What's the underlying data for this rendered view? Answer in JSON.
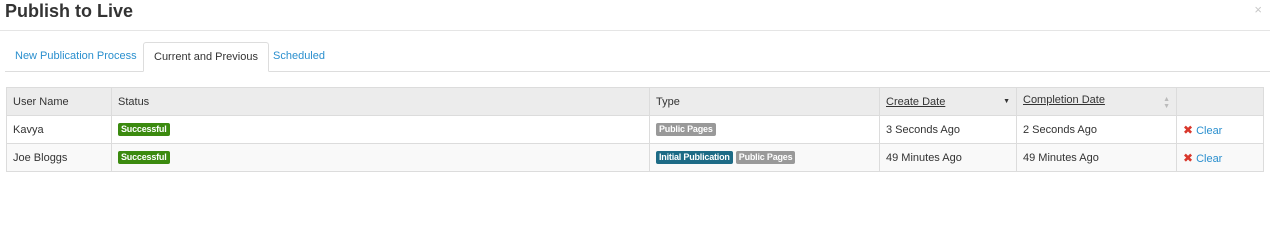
{
  "dialog": {
    "title": "Publish to Live",
    "close_glyph": "×"
  },
  "tabs": [
    {
      "label": "New Publication Process",
      "active": false
    },
    {
      "label": "Current and Previous",
      "active": true
    },
    {
      "label": "Scheduled",
      "active": false
    }
  ],
  "table": {
    "headers": {
      "user_name": "User Name",
      "status": "Status",
      "type": "Type",
      "create_date": "Create Date",
      "completion_date": "Completion Date"
    },
    "sort": {
      "create_date": "descending",
      "completion_date": "unsorted"
    },
    "rows": [
      {
        "user_name": "Kavya",
        "status": "Successful",
        "types": [
          "Public Pages"
        ],
        "create_date": "3 Seconds Ago",
        "completion_date": "2 Seconds Ago",
        "action": "Clear"
      },
      {
        "user_name": "Joe Bloggs",
        "status": "Successful",
        "types": [
          "Initial Publication",
          "Public Pages"
        ],
        "create_date": "49 Minutes Ago",
        "completion_date": "49 Minutes Ago",
        "action": "Clear"
      }
    ]
  },
  "colors": {
    "success": "#3b8a0f",
    "label_gray": "#999999",
    "label_teal": "#1d6b86",
    "link": "#2a8fce",
    "delete_icon": "#d9372b"
  },
  "icons": {
    "close": "close-icon",
    "sort_desc": "sort-desc-icon",
    "sort_both": "sort-both-icon",
    "delete": "delete-x-icon"
  }
}
